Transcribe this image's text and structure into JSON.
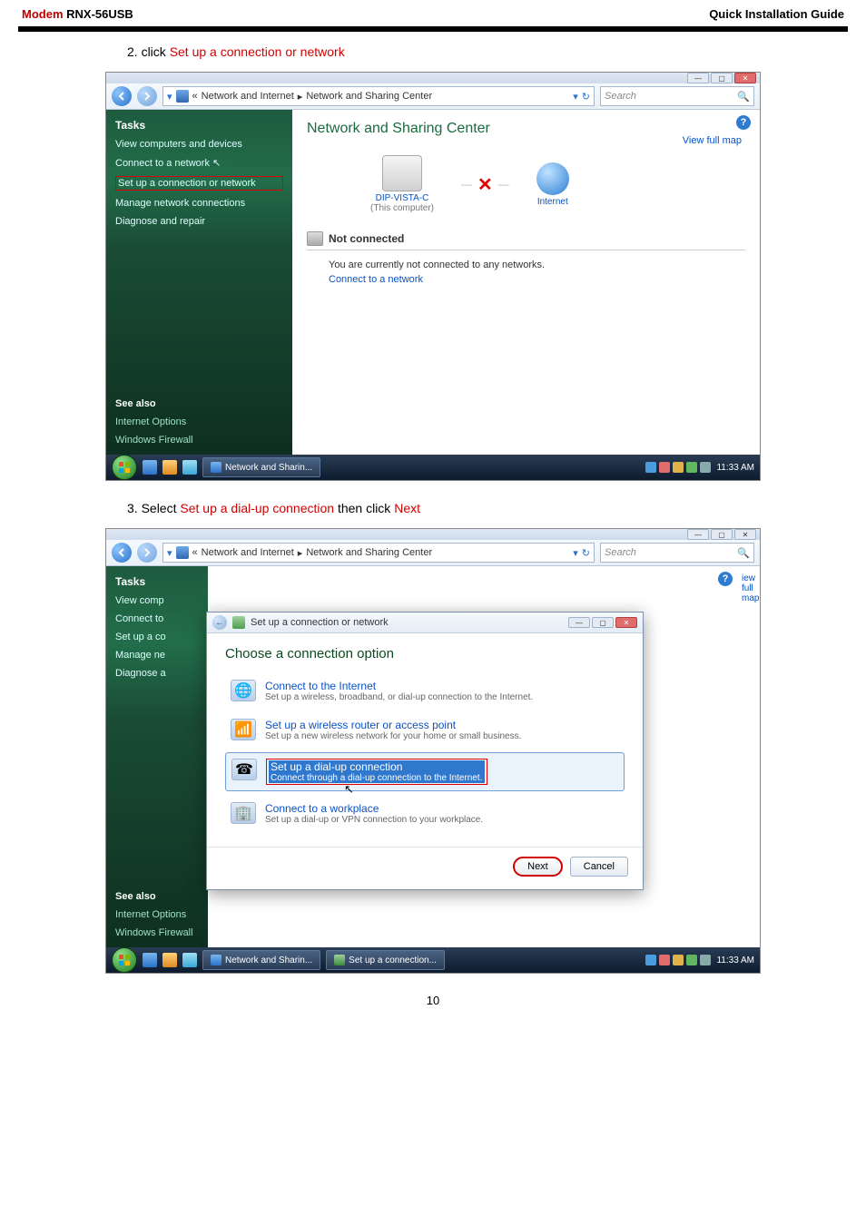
{
  "header": {
    "brand": "Modem",
    "model": "RNX-56USB",
    "guide": "Quick Installation Guide"
  },
  "step2": {
    "prefix": "2. click ",
    "link": "Set up a connection or network"
  },
  "step3": {
    "prefix": "3. Select ",
    "link1": "Set up a dial-up connection",
    "mid": " then click ",
    "link2": "Next"
  },
  "ss1": {
    "breadcrumb_prefix": "«",
    "breadcrumb_a": "Network and Internet",
    "breadcrumb_sep": "▸",
    "breadcrumb_b": "Network and Sharing Center",
    "search_placeholder": "Search",
    "tasks_title": "Tasks",
    "tasks": {
      "t1": "View computers and devices",
      "t2": "Connect to a network",
      "t3": "Set up a connection or network",
      "t4": "Manage network connections",
      "t5": "Diagnose and repair"
    },
    "see_also": "See also",
    "see1": "Internet Options",
    "see2": "Windows Firewall",
    "nsc_title": "Network and Sharing Center",
    "view_full_map": "View full map",
    "node1": "DIP-VISTA-C",
    "node1_sub": "(This computer)",
    "node2": "Internet",
    "not_connected": "Not connected",
    "msg": "You are currently not connected to any networks.",
    "connect_link": "Connect to a network",
    "taskbar_app": "Network and Sharin...",
    "time": "11:33 AM"
  },
  "ss2": {
    "breadcrumb_prefix": "«",
    "breadcrumb_a": "Network and Internet",
    "breadcrumb_sep": "▸",
    "breadcrumb_b": "Network and Sharing Center",
    "search_placeholder": "Search",
    "tasks_title": "Tasks",
    "tasks": {
      "t1": "View comp",
      "t2": "Connect to",
      "t3": "Set up a co",
      "t4": "Manage ne",
      "t5": "Diagnose a"
    },
    "see_also": "See also",
    "see1": "Internet Options",
    "see2": "Windows Firewall",
    "right_strip": "iew full map",
    "wiz_title": "Set up a connection or network",
    "wiz_head": "Choose a connection option",
    "opt1_t": "Connect to the Internet",
    "opt1_s": "Set up a wireless, broadband, or dial-up connection to the Internet.",
    "opt2_t": "Set up a wireless router or access point",
    "opt2_s": "Set up a new wireless network for your home or small business.",
    "opt3_t": "Set up a dial-up connection",
    "opt3_s": "Connect through a dial-up connection to the Internet.",
    "opt4_t": "Connect to a workplace",
    "opt4_s": "Set up a dial-up or VPN connection to your workplace.",
    "btn_next": "Next",
    "btn_cancel": "Cancel",
    "taskbar_app1": "Network and Sharin...",
    "taskbar_app2": "Set up a connection...",
    "time": "11:33 AM"
  },
  "page_num": "10"
}
